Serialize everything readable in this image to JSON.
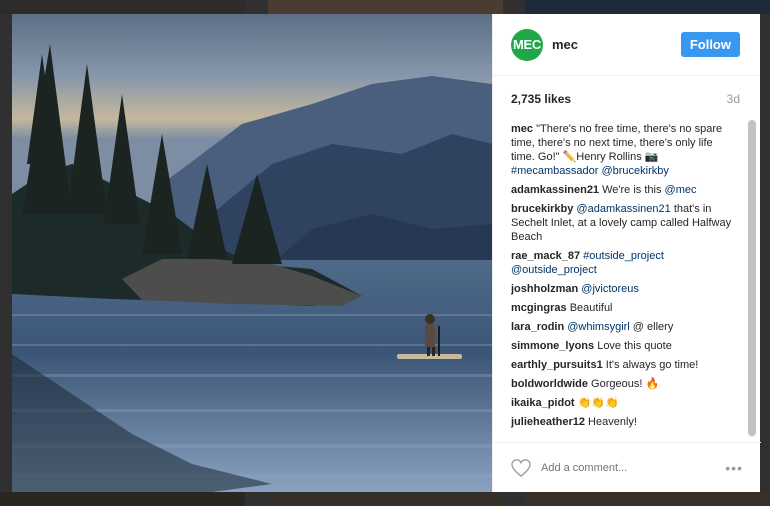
{
  "post": {
    "username": "mec",
    "avatar_text": "MEC",
    "follow_label": "Follow",
    "likes": "2,735 likes",
    "time_ago": "3d",
    "add_comment_placeholder": "Add a comment...",
    "more_label": "•••"
  },
  "caption": {
    "user": "mec",
    "text": " \"There's no free time, there's no spare time, there's no next time, there's only life time. Go!\" ✏️Henry Rollins 📷 ",
    "tags": "#mecambassador @brucekirkby"
  },
  "comments": [
    {
      "user": "adamkassinen21",
      "text": " We're is this ",
      "link": "@mec"
    },
    {
      "user": "brucekirkby",
      "link": " @adamkassinen21",
      "text": " that's in Sechelt Inlet, at a lovely camp called Halfway Beach"
    },
    {
      "user": "rae_mack_87",
      "link": " #outside_project @outside_project",
      "text": ""
    },
    {
      "user": "joshholzman",
      "link": " @jvictoreus",
      "text": ""
    },
    {
      "user": "mcgingras",
      "text": " Beautiful",
      "link": ""
    },
    {
      "user": "lara_rodin",
      "link": " @whimsygirl",
      "text": " @ ellery"
    },
    {
      "user": "simmone_lyons",
      "text": " Love this quote",
      "link": ""
    },
    {
      "user": "earthly_pursuits1",
      "text": " It's always go time!",
      "link": ""
    },
    {
      "user": "boldworldwide",
      "text": " Gorgeous! 🔥",
      "link": ""
    },
    {
      "user": "ikaika_pidot",
      "text": " 👏👏👏",
      "link": ""
    },
    {
      "user": "julieheather12",
      "text": " Heavenly!",
      "link": ""
    }
  ],
  "colors": {
    "follow_button": "#3897f0",
    "avatar_bg": "#1fa84a",
    "link": "#003569"
  }
}
